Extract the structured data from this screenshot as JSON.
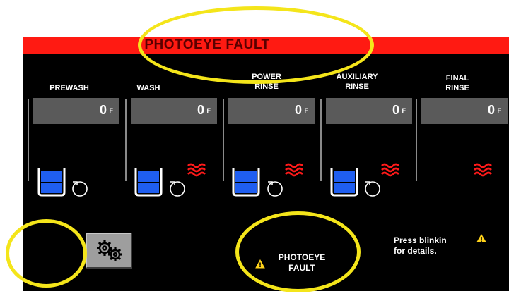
{
  "header": {
    "title": "PHOTOEYE FAULT"
  },
  "stations": [
    {
      "label": "PREWASH",
      "temp_value": "0",
      "temp_unit": "F",
      "tank": true,
      "pump": true,
      "heater": false
    },
    {
      "label": "WASH",
      "temp_value": "0",
      "temp_unit": "F",
      "tank": true,
      "pump": true,
      "heater": true
    },
    {
      "label": "POWER RINSE",
      "temp_value": "0",
      "temp_unit": "F",
      "tank": true,
      "pump": true,
      "heater": true
    },
    {
      "label": "AUXILIARY RINSE",
      "temp_value": "0",
      "temp_unit": "F",
      "tank": true,
      "pump": true,
      "heater": true
    },
    {
      "label": "FINAL RINSE",
      "temp_value": "0",
      "temp_unit": "F",
      "tank": false,
      "pump": false,
      "heater": true
    }
  ],
  "fault": {
    "line1": "PHOTOEYE",
    "line2": "FAULT"
  },
  "details": {
    "line1": "Press blinkin",
    "line2": "for details."
  },
  "icons": {
    "settings": "gears-icon",
    "warning": "warning-triangle-icon",
    "heater": "heater-waves-icon",
    "tank": "tank-icon",
    "pump": "pump-icon"
  },
  "colors": {
    "header": "#ff1a12",
    "tank_blue": "#1f5ef0",
    "heater_red": "#ff1a1a",
    "warning_yellow": "#ffd21a",
    "highlight": "#f4e51a",
    "temp_box": "#5a5a5a"
  }
}
